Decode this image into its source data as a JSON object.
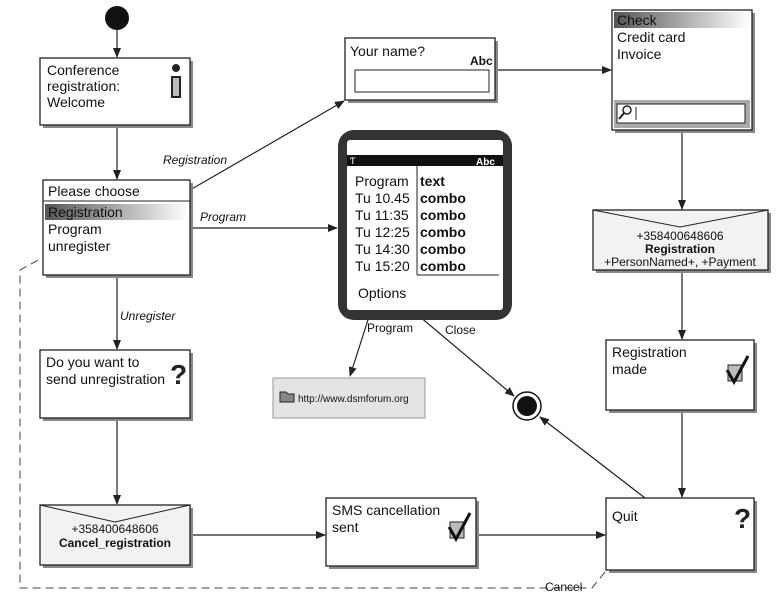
{
  "welcome": {
    "lines": [
      "Conference",
      "registration:",
      "Welcome"
    ]
  },
  "choose": {
    "title": "Please choose",
    "items": [
      "Registration",
      "Program",
      "unregister"
    ],
    "selected": "Registration"
  },
  "name_prompt": {
    "title": "Your name?",
    "input_mode": "Abc",
    "value": ""
  },
  "phone": {
    "input_mode": "Abc",
    "rows": [
      {
        "label": "Program",
        "value": "text"
      },
      {
        "label": "Tu 10.45",
        "value": "combo"
      },
      {
        "label": "Tu 11:35",
        "value": "combo"
      },
      {
        "label": "Tu 12:25",
        "value": "combo"
      },
      {
        "label": "Tu 14:30",
        "value": "combo"
      },
      {
        "label": "Tu 15:20",
        "value": "combo"
      }
    ],
    "softkey": "Options"
  },
  "payment": {
    "items": [
      "Check",
      "Credit card",
      "Invoice"
    ],
    "selected": "Check",
    "search_value": ""
  },
  "sms_registration": {
    "number": "+358400648606",
    "keyword": "Registration",
    "params": "+PersonNamed+, +Payment"
  },
  "registration_made": {
    "lines": [
      "Registration",
      "made"
    ]
  },
  "quit": {
    "title": "Quit"
  },
  "link": {
    "url": "http://www.dsmforum.org"
  },
  "unregister_confirm": {
    "lines": [
      "Do you want to",
      "send unregistration"
    ]
  },
  "sms_cancel": {
    "number": "+358400648606",
    "keyword": "Cancel_registration"
  },
  "cancel_sent": {
    "lines": [
      "SMS  cancellation",
      "sent"
    ]
  },
  "edges": {
    "registration": "Registration",
    "program": "Program",
    "unregister": "Unregister",
    "program_link": "Program",
    "close": "Close",
    "cancel": "Cancel"
  },
  "colors": {
    "highlight_start": "#555555",
    "highlight_end": "#ffffff",
    "sms_fill": "#f2f2f2",
    "link_fill": "#e4e4e4"
  }
}
